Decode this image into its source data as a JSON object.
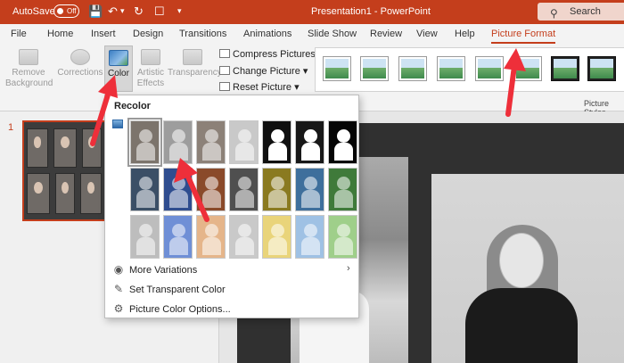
{
  "titlebar": {
    "autosave_label": "AutoSave",
    "autosave_state": "Off",
    "document_title": "Presentation1 - PowerPoint",
    "search_placeholder": "Search"
  },
  "menu": {
    "tabs": [
      {
        "label": "File"
      },
      {
        "label": "Home"
      },
      {
        "label": "Insert"
      },
      {
        "label": "Design"
      },
      {
        "label": "Transitions"
      },
      {
        "label": "Animations"
      },
      {
        "label": "Slide Show"
      },
      {
        "label": "Review"
      },
      {
        "label": "View"
      },
      {
        "label": "Help"
      },
      {
        "label": "Picture Format",
        "active": true
      }
    ]
  },
  "ribbon": {
    "remove_background": "Remove Background",
    "corrections": "Corrections",
    "color": "Color",
    "artistic_effects": "Artistic Effects",
    "transparency": "Transparency",
    "compress_pictures": "Compress Pictures",
    "change_picture": "Change Picture",
    "reset_picture": "Reset Picture",
    "picture_styles_label": "Picture Styles"
  },
  "slides": {
    "number": "1"
  },
  "recolor_menu": {
    "title": "Recolor",
    "swatches_row1": [
      "#7c746c",
      "#9d9d9d",
      "#8c8178",
      "#c9c9c9",
      "#101010",
      "#181818",
      "#050505"
    ],
    "swatches_row2": [
      "#3b4f66",
      "#2f4d8f",
      "#8a4a2a",
      "#4f4f4f",
      "#8a7a20",
      "#3e6f9c",
      "#3f7a3a"
    ],
    "swatches_row3": [
      "#bdbdbd",
      "#6f8fd6",
      "#e5b58a",
      "#c9c9c9",
      "#e9d47a",
      "#9fc1e4",
      "#9fcf8a"
    ],
    "more_variations": "More Variations",
    "set_transparent_color": "Set Transparent Color",
    "picture_color_options": "Picture Color Options..."
  },
  "colors": {
    "accent": "#c43e1c",
    "arrow": "#ee2f3a"
  }
}
